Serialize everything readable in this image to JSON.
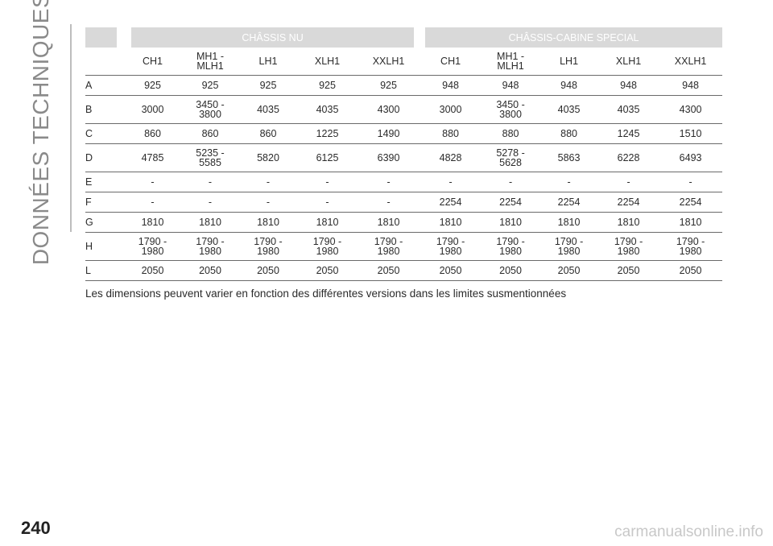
{
  "sidebar": {
    "section_title": "DONNÉES TECHNIQUES"
  },
  "table": {
    "group_headers": [
      "CHÂSSIS NU",
      "CHÂSSIS-CABINE SPECIAL"
    ],
    "columns": [
      "CH1",
      "MH1 -\nMLH1",
      "LH1",
      "XLH1",
      "XXLH1",
      "CH1",
      "MH1 -\nMLH1",
      "LH1",
      "XLH1",
      "XXLH1"
    ],
    "rows": [
      {
        "label": "A",
        "values": [
          "925",
          "925",
          "925",
          "925",
          "925",
          "948",
          "948",
          "948",
          "948",
          "948"
        ]
      },
      {
        "label": "B",
        "values": [
          "3000",
          "3450 -\n3800",
          "4035",
          "4035",
          "4300",
          "3000",
          "3450 -\n3800",
          "4035",
          "4035",
          "4300"
        ]
      },
      {
        "label": "C",
        "values": [
          "860",
          "860",
          "860",
          "1225",
          "1490",
          "880",
          "880",
          "880",
          "1245",
          "1510"
        ]
      },
      {
        "label": "D",
        "values": [
          "4785",
          "5235 -\n5585",
          "5820",
          "6125",
          "6390",
          "4828",
          "5278 -\n5628",
          "5863",
          "6228",
          "6493"
        ]
      },
      {
        "label": "E",
        "values": [
          "-",
          "-",
          "-",
          "-",
          "-",
          "-",
          "-",
          "-",
          "-",
          "-"
        ]
      },
      {
        "label": "F",
        "values": [
          "-",
          "-",
          "-",
          "-",
          "-",
          "2254",
          "2254",
          "2254",
          "2254",
          "2254"
        ]
      },
      {
        "label": "G",
        "values": [
          "1810",
          "1810",
          "1810",
          "1810",
          "1810",
          "1810",
          "1810",
          "1810",
          "1810",
          "1810"
        ]
      },
      {
        "label": "H",
        "values": [
          "1790 -\n1980",
          "1790 -\n1980",
          "1790 -\n1980",
          "1790 -\n1980",
          "1790 -\n1980",
          "1790 -\n1980",
          "1790 -\n1980",
          "1790 -\n1980",
          "1790 -\n1980",
          "1790 -\n1980"
        ]
      },
      {
        "label": "L",
        "values": [
          "2050",
          "2050",
          "2050",
          "2050",
          "2050",
          "2050",
          "2050",
          "2050",
          "2050",
          "2050"
        ]
      }
    ]
  },
  "note": "Les dimensions peuvent varier en fonction des différentes versions dans les limites susmentionnées",
  "page_number": "240",
  "watermark": "carmanualsonline.info",
  "colors": {
    "header_fill": "#d9d9d9",
    "rule": "#6a6a6a",
    "section_title": "#8a8a8a"
  }
}
